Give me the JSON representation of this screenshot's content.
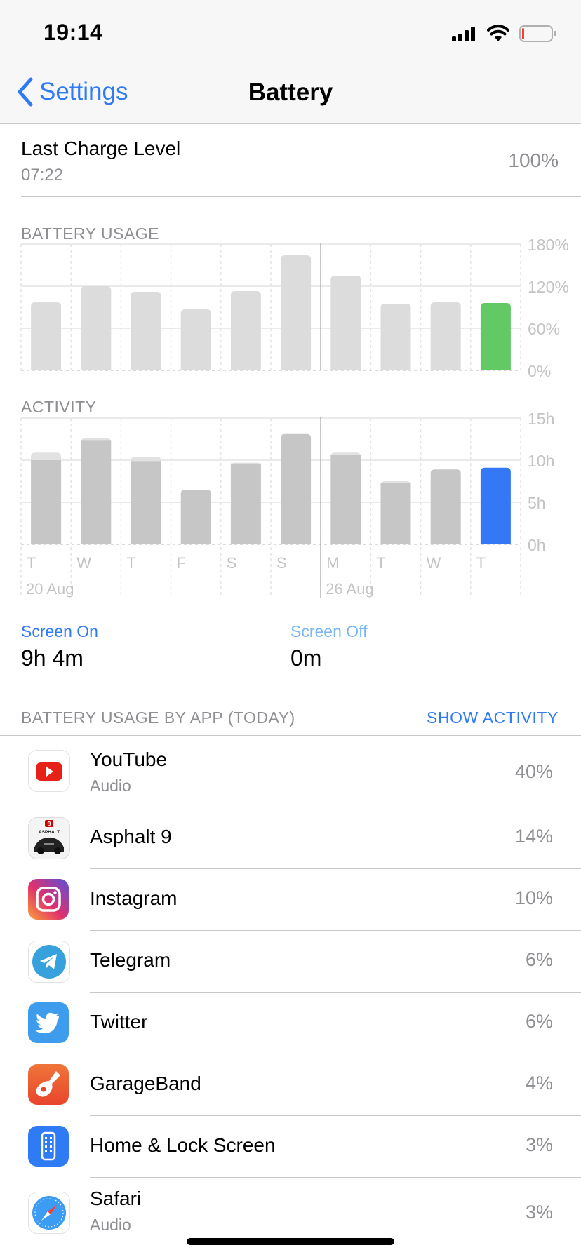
{
  "status_bar": {
    "time": "19:14",
    "battery_color": "#ff3b30"
  },
  "nav": {
    "back_label": "Settings",
    "title": "Battery"
  },
  "last_charge": {
    "label": "Last Charge Level",
    "time": "07:22",
    "value": "100%"
  },
  "battery_usage": {
    "heading": "BATTERY USAGE",
    "y_ticks": [
      "180%",
      "120%",
      "60%",
      "0%"
    ]
  },
  "activity": {
    "heading": "ACTIVITY",
    "y_ticks": [
      "15h",
      "10h",
      "5h",
      "0h"
    ],
    "day_labels": [
      "T",
      "W",
      "T",
      "F",
      "S",
      "S",
      "M",
      "T",
      "W",
      "T"
    ],
    "date_labels": [
      "20 Aug",
      "26 Aug"
    ]
  },
  "chart_data": [
    {
      "type": "bar",
      "title": "BATTERY USAGE",
      "categories": [
        "T",
        "W",
        "T",
        "F",
        "S",
        "S",
        "M",
        "T",
        "W",
        "T"
      ],
      "values": [
        97,
        120,
        112,
        87,
        113,
        164,
        135,
        95,
        97,
        96
      ],
      "ylim": [
        0,
        180
      ],
      "highlight_index": 9,
      "colors": {
        "bar": "#dcdcdc",
        "highlight": "#63c965"
      }
    },
    {
      "type": "bar",
      "title": "ACTIVITY",
      "categories": [
        "T",
        "W",
        "T",
        "F",
        "S",
        "S",
        "M",
        "T",
        "W",
        "T"
      ],
      "series": [
        {
          "values": [
            10.0,
            12.4,
            9.9,
            6.5,
            9.6,
            13.1,
            10.6,
            7.3,
            8.9,
            9.1
          ]
        },
        {
          "values": [
            0.9,
            0.2,
            0.5,
            0,
            0.1,
            0,
            0.3,
            0.2,
            0,
            0
          ]
        }
      ],
      "ylim": [
        0,
        15
      ],
      "highlight_index": 9,
      "colors": {
        "bar": "#c6c6c6",
        "top": "#e2e2e2",
        "highlight": "#3478f6"
      }
    }
  ],
  "screen": {
    "on_label": "Screen On",
    "on_value": "9h 4m",
    "off_label": "Screen Off",
    "off_value": "0m"
  },
  "apps_section": {
    "heading": "BATTERY USAGE BY APP (TODAY)",
    "action": "SHOW ACTIVITY"
  },
  "apps": [
    {
      "name": "YouTube",
      "sub": "Audio",
      "pct": "40%",
      "icon": "youtube-icon"
    },
    {
      "name": "Asphalt 9",
      "sub": "",
      "pct": "14%",
      "icon": "asphalt-9-icon",
      "icon_text": "ASPHALT"
    },
    {
      "name": "Instagram",
      "sub": "",
      "pct": "10%",
      "icon": "instagram-icon"
    },
    {
      "name": "Telegram",
      "sub": "",
      "pct": "6%",
      "icon": "telegram-icon"
    },
    {
      "name": "Twitter",
      "sub": "",
      "pct": "6%",
      "icon": "twitter-icon"
    },
    {
      "name": "GarageBand",
      "sub": "",
      "pct": "4%",
      "icon": "garageband-icon"
    },
    {
      "name": "Home & Lock Screen",
      "sub": "",
      "pct": "3%",
      "icon": "home-lock-screen-icon"
    },
    {
      "name": "Safari",
      "sub": "Audio",
      "pct": "3%",
      "icon": "safari-icon"
    }
  ]
}
